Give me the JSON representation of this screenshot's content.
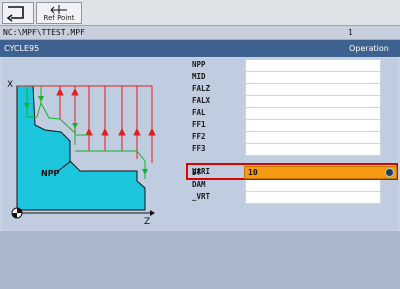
{
  "toolbar": {
    "back_icon": "back-arrow-icon",
    "refpoint_icon": "refpoint-icon",
    "refpoint_label": "Ref Point"
  },
  "pathbar": {
    "path": "NC:\\MPF\\TTEST.MPF",
    "channel": "1"
  },
  "cycle": {
    "name": "CYCLE95",
    "mode": "Operation"
  },
  "graphic": {
    "npp_label": "NPP",
    "x_label": "X",
    "z_label": "Z",
    "workpiece_color": "#1bc5dc",
    "pass_color_red": "#e02020",
    "pass_color_green": "#18b02c"
  },
  "params": [
    {
      "name": "NPP",
      "value": ""
    },
    {
      "name": "MID",
      "value": ""
    },
    {
      "name": "FALZ",
      "value": ""
    },
    {
      "name": "FALX",
      "value": ""
    },
    {
      "name": "FAL",
      "value": ""
    },
    {
      "name": "FF1",
      "value": ""
    },
    {
      "name": "FF2",
      "value": ""
    },
    {
      "name": "FF3",
      "value": ""
    },
    {
      "name": "VARI",
      "value": "10"
    },
    {
      "name": "DT",
      "value": ""
    },
    {
      "name": "DAM",
      "value": ""
    },
    {
      "name": "_VRT",
      "value": ""
    }
  ],
  "colors": {
    "title_bg": "#3e628f",
    "active_field": "#f59a12",
    "active_border": "#e00000"
  }
}
